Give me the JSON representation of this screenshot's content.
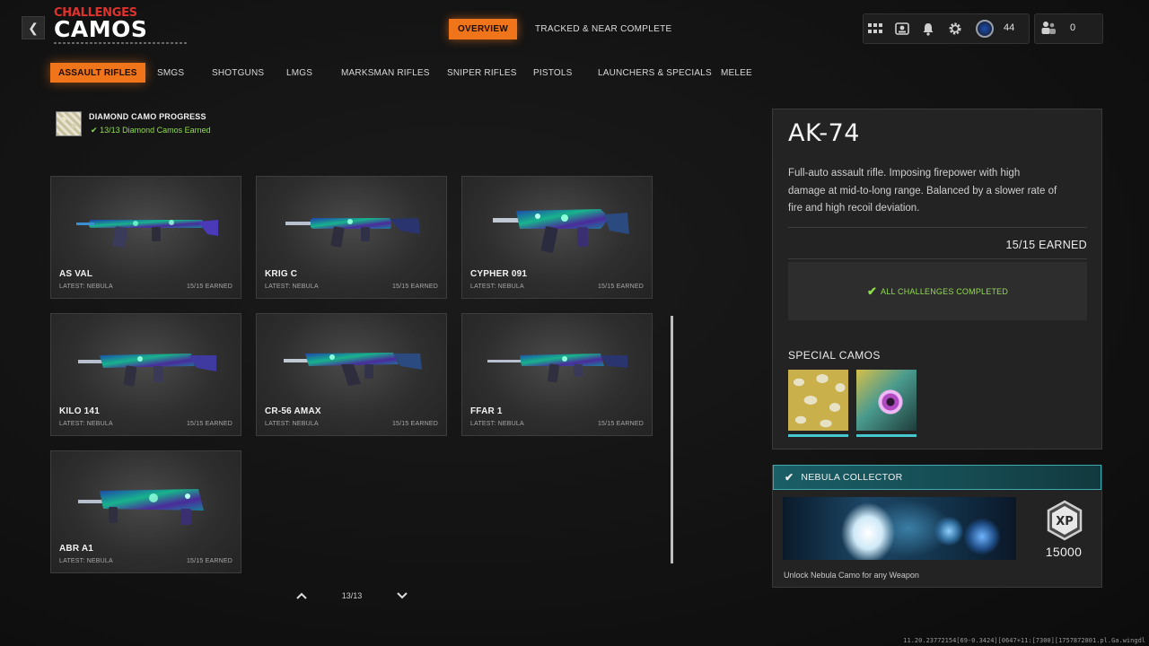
{
  "header": {
    "back_icon": "chevron-left-icon",
    "section": "CHALLENGES",
    "title": "CAMOS",
    "tabs": [
      {
        "label": "OVERVIEW",
        "active": true
      },
      {
        "label": "TRACKED & NEAR COMPLETE",
        "active": false
      }
    ],
    "hud": {
      "icons": [
        "grid-icon",
        "id-card-icon",
        "bell-icon",
        "gear-icon"
      ],
      "level_icon": "prestige-badge-icon",
      "level": "44",
      "party_icon": "party-icon",
      "party_count": "0"
    }
  },
  "categories": [
    {
      "label": "ASSAULT RIFLES",
      "active": true
    },
    {
      "label": "SMGS",
      "active": false
    },
    {
      "label": "SHOTGUNS",
      "active": false
    },
    {
      "label": "LMGS",
      "active": false
    },
    {
      "label": "MARKSMAN RIFLES",
      "active": false
    },
    {
      "label": "SNIPER RIFLES",
      "active": false
    },
    {
      "label": "PISTOLS",
      "active": false
    },
    {
      "label": "LAUNCHERS & SPECIALS",
      "active": false
    },
    {
      "label": "MELEE",
      "active": false
    }
  ],
  "diamond_progress": {
    "title": "DIAMOND CAMO PROGRESS",
    "status": "13/13 Diamond Camos Earned"
  },
  "weapons": [
    {
      "name": "AS VAL",
      "latest": "LATEST: NEBULA",
      "earned": "15/15 EARNED"
    },
    {
      "name": "KRIG C",
      "latest": "LATEST: NEBULA",
      "earned": "15/15 EARNED"
    },
    {
      "name": "CYPHER 091",
      "latest": "LATEST: NEBULA",
      "earned": "15/15 EARNED"
    },
    {
      "name": "KILO 141",
      "latest": "LATEST: NEBULA",
      "earned": "15/15 EARNED"
    },
    {
      "name": "CR-56 AMAX",
      "latest": "LATEST: NEBULA",
      "earned": "15/15 EARNED"
    },
    {
      "name": "FFAR 1",
      "latest": "LATEST: NEBULA",
      "earned": "15/15 EARNED"
    },
    {
      "name": "ABR A1",
      "latest": "LATEST: NEBULA",
      "earned": "15/15 EARNED"
    }
  ],
  "pagination": {
    "up_icon": "chevron-up-icon",
    "down_icon": "chevron-down-icon",
    "count": "13/13"
  },
  "detail": {
    "title": "AK-74",
    "description": "Full-auto assault rifle.  Imposing firepower with high damage at mid-to-long range. Balanced by a slower rate of fire and high recoil deviation.",
    "earned": "15/15 EARNED",
    "completed": "ALL CHALLENGES COMPLETED",
    "special_camos_label": "SPECIAL CAMOS"
  },
  "nebula_collector": {
    "title": "NEBULA COLLECTOR",
    "description": "Unlock Nebula Camo for any Weapon",
    "xp_icon": "xp-icon",
    "xp": "15000"
  },
  "footer": "11.20.23772154[69-0.3424][0647+11:[7300][1757872801.pl.Ga.wingdl",
  "colors": {
    "accent": "#f0741a",
    "success": "#8fdc4c",
    "section_red": "#e0322c",
    "teal": "#45c7cf"
  }
}
